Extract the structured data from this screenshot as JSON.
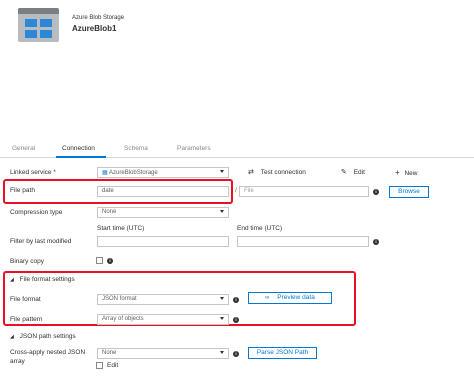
{
  "header": {
    "dataset_type": "Azure Blob Storage",
    "dataset_name": "AzureBlob1"
  },
  "tabs": [
    {
      "label": "General"
    },
    {
      "label": "Connection"
    },
    {
      "label": "Schema"
    },
    {
      "label": "Parameters"
    }
  ],
  "connection": {
    "linked_service_label": "Linked service",
    "required_mark": "*",
    "linked_service_value": "AzureBlobStorage",
    "test_connection_label": "Test connection",
    "edit_label": "Edit",
    "new_label": "New",
    "file_path_label": "File path",
    "file_path_container": "date",
    "file_path_separator": "/",
    "file_path_file_placeholder": "File",
    "browse_label": "Browse",
    "compression_type_label": "Compression type",
    "compression_type_value": "None",
    "filter_label": "Filter by last modified",
    "start_time_label": "Start time (UTC)",
    "end_time_label": "End time (UTC)",
    "binary_copy_label": "Binary copy",
    "file_format_settings_label": "File format settings",
    "file_format_label": "File format",
    "file_format_value": "JSON format",
    "preview_data_label": "Preview data",
    "file_pattern_label": "File pattern",
    "file_pattern_value": "Array of objects",
    "json_path_settings_label": "JSON path settings",
    "cross_apply_label_line1": "Cross-apply nested JSON",
    "cross_apply_label_line2": "array",
    "cross_apply_value": "None",
    "parse_json_path_label": "Parse JSON Path",
    "edit_checkbox_label": "Edit",
    "info_glyph": "i"
  },
  "colors": {
    "accent": "#0078d4",
    "highlight": "#e81123"
  }
}
